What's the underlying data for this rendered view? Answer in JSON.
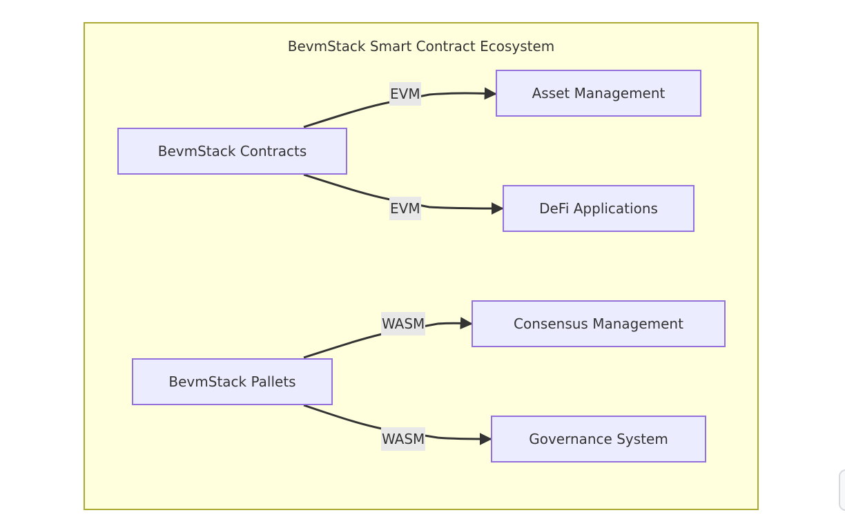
{
  "diagram": {
    "cluster": {
      "title": "BevmStack Smart Contract Ecosystem"
    },
    "nodes": {
      "contracts": "BevmStack Contracts",
      "pallets": "BevmStack Pallets",
      "asset": "Asset Management",
      "defi": "DeFi Applications",
      "consensus": "Consensus Management",
      "governance": "Governance System"
    },
    "edges": [
      {
        "from": "contracts",
        "to": "asset",
        "label": "EVM"
      },
      {
        "from": "contracts",
        "to": "defi",
        "label": "EVM"
      },
      {
        "from": "pallets",
        "to": "consensus",
        "label": "WASM"
      },
      {
        "from": "pallets",
        "to": "governance",
        "label": "WASM"
      }
    ],
    "colors": {
      "cluster_fill": "#ffffde",
      "cluster_border": "#aaaa33",
      "node_fill": "#ececff",
      "node_border": "#9370db",
      "edge": "#333333",
      "label_bg": "#e8e8e8"
    }
  }
}
